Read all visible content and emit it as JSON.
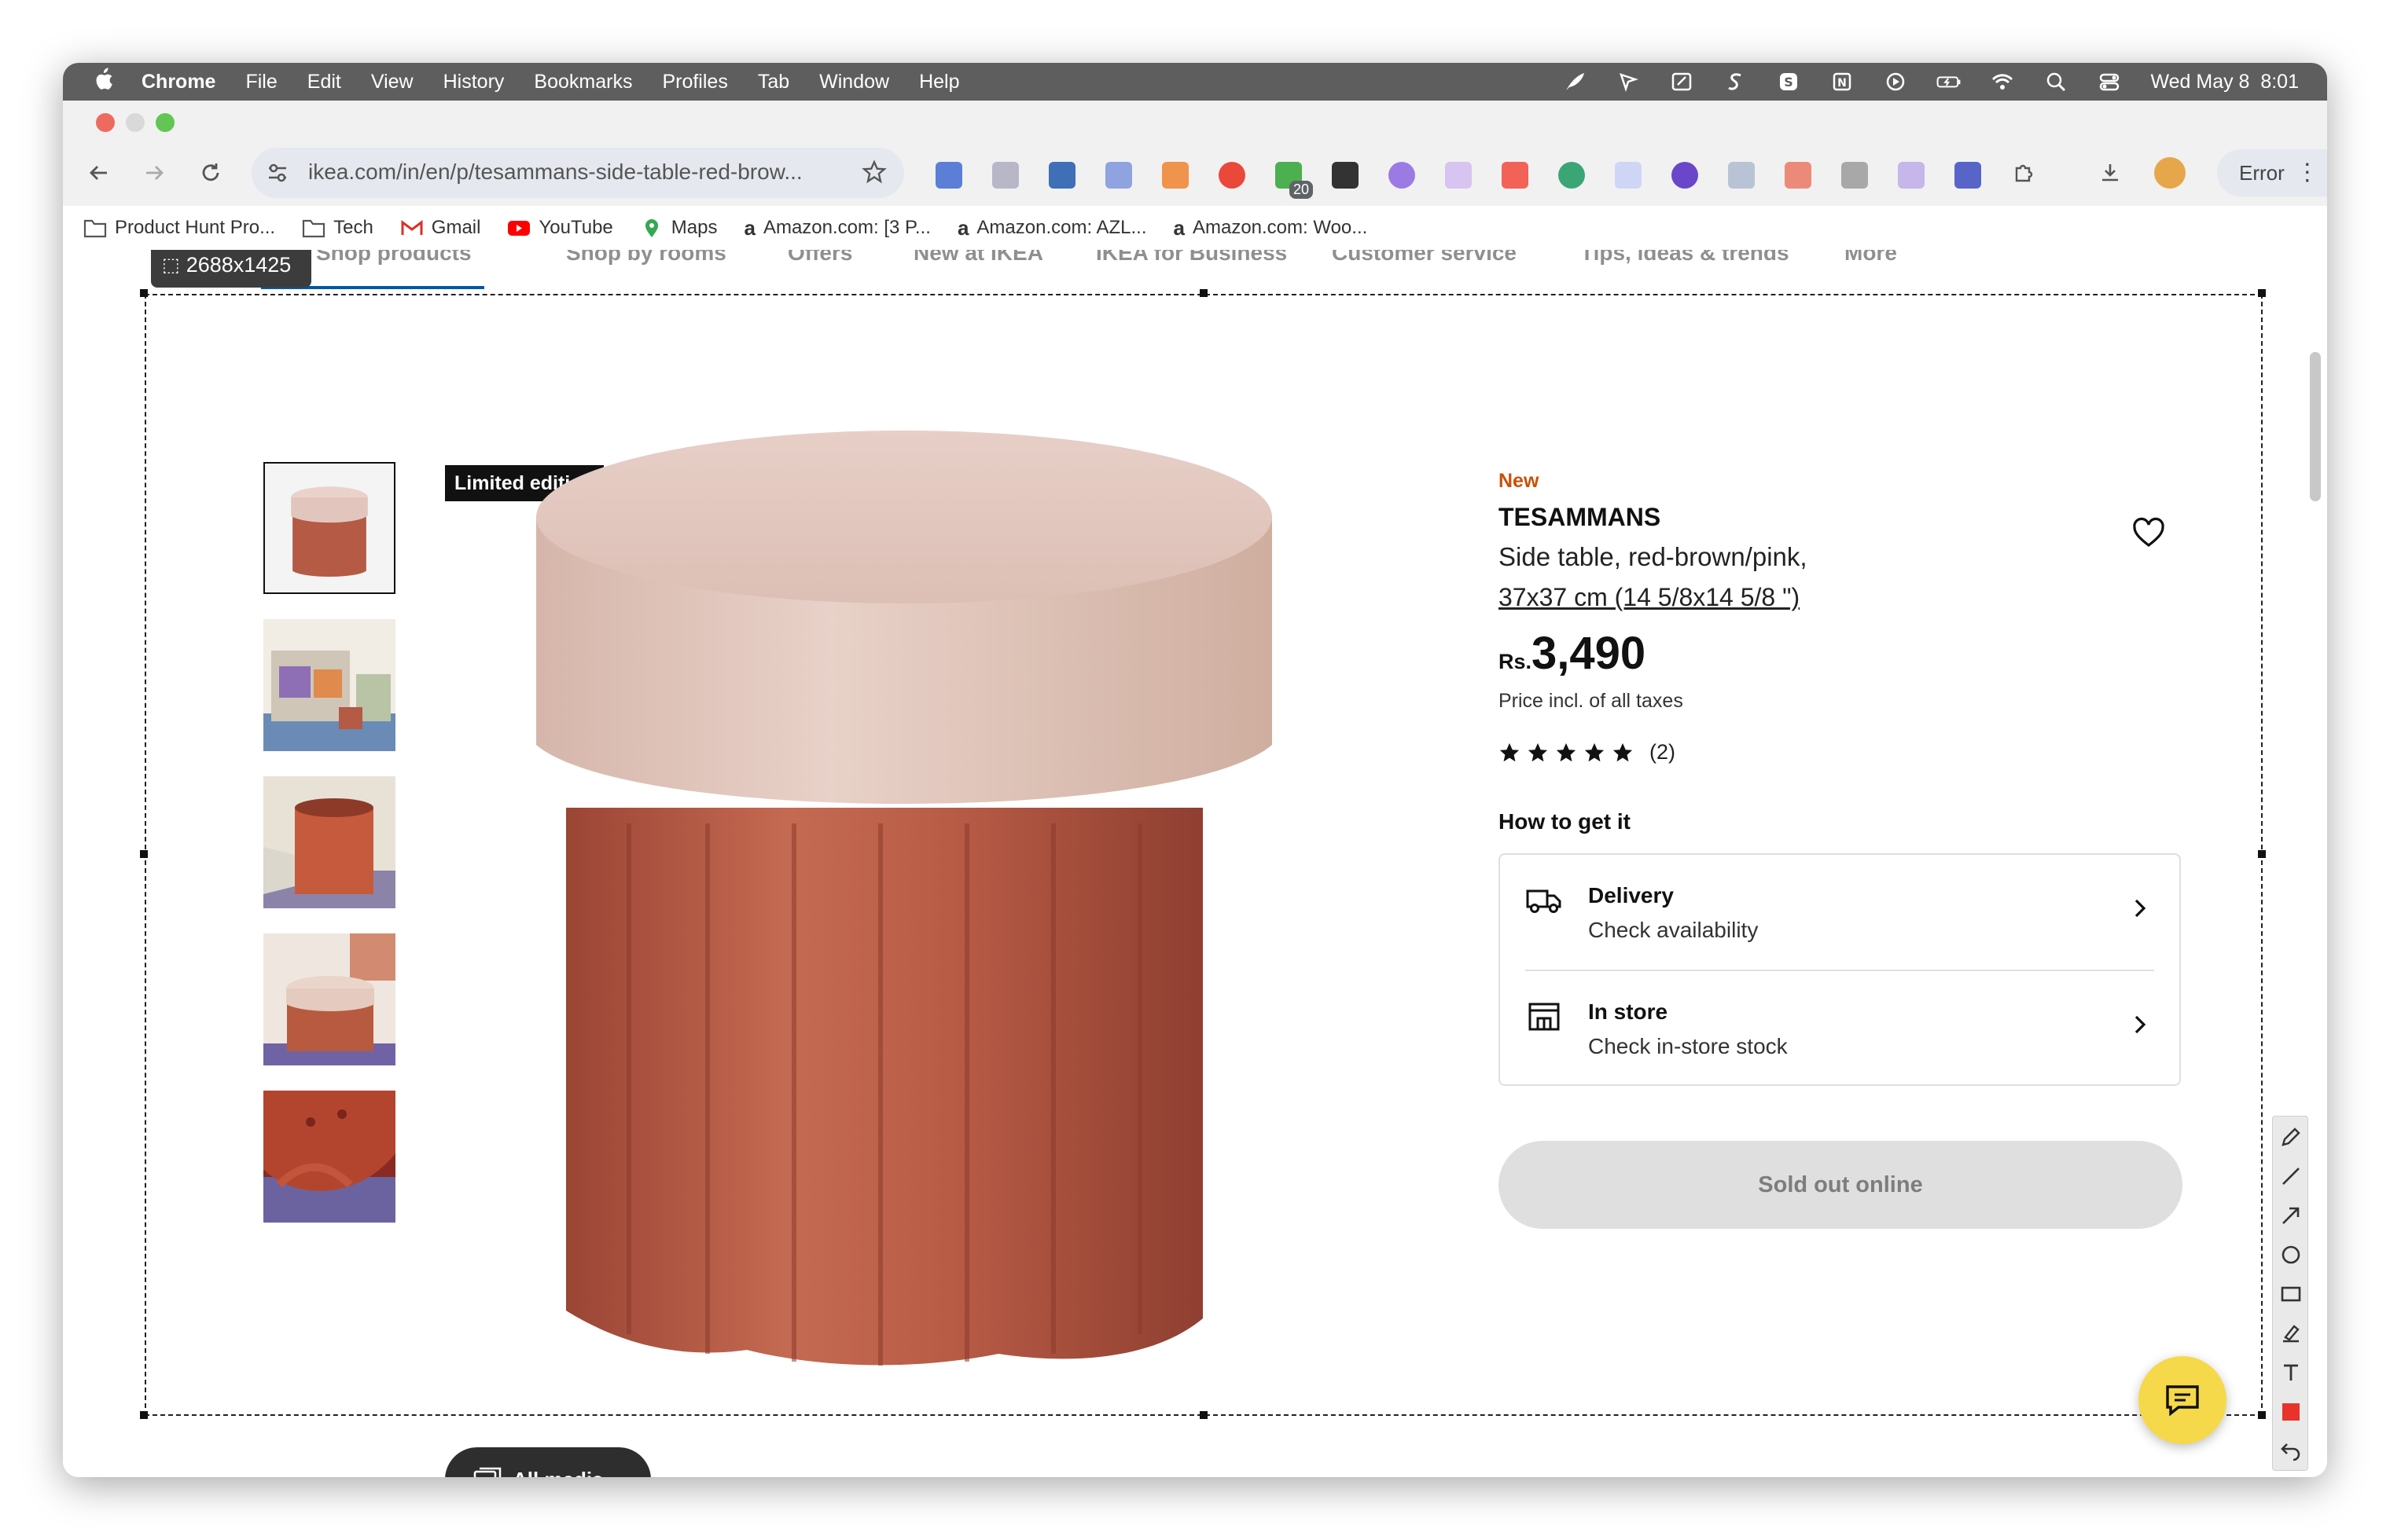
{
  "menubar": {
    "app": "Chrome",
    "items": [
      "File",
      "Edit",
      "View",
      "History",
      "Bookmarks",
      "Profiles",
      "Tab",
      "Window",
      "Help"
    ],
    "clock": "Wed May 8  8:01"
  },
  "toolbar": {
    "url": "ikea.com/in/en/p/tesammans-side-table-red-brow...",
    "extension_badge": "20",
    "error_label": "Error"
  },
  "bookmarks": [
    {
      "label": "Product Hunt Pro...",
      "icon": "folder-icon"
    },
    {
      "label": "Tech",
      "icon": "folder-icon"
    },
    {
      "label": "Gmail",
      "icon": "gmail-icon"
    },
    {
      "label": "YouTube",
      "icon": "youtube-icon"
    },
    {
      "label": "Maps",
      "icon": "maps-icon"
    },
    {
      "label": "Amazon.com: [3 P...",
      "icon": "amazon-icon"
    },
    {
      "label": "Amazon.com: AZL...",
      "icon": "amazon-icon"
    },
    {
      "label": "Amazon.com: Woo...",
      "icon": "amazon-icon"
    }
  ],
  "site_nav": [
    "Shop products",
    "Shop by rooms",
    "Offers",
    "New at IKEA",
    "IKEA for Business",
    "Customer service",
    "Tips, ideas & trends",
    "More"
  ],
  "capture": {
    "size_label": "2688x1425"
  },
  "gallery": {
    "badge": "Limited edition",
    "all_media_label": "All media"
  },
  "product": {
    "tag": "New",
    "name": "TESAMMANS",
    "description": "Side table, red-brown/pink,",
    "size": "37x37 cm (14 5/8x14 5/8 \")",
    "currency": "Rs.",
    "price": "3,490",
    "tax_note": "Price incl. of all taxes",
    "rating": 5,
    "review_count": "(2)"
  },
  "how_to_get": {
    "heading": "How to get it",
    "options": [
      {
        "title": "Delivery",
        "subtitle": "Check availability",
        "icon": "truck-icon"
      },
      {
        "title": "In store",
        "subtitle": "Check in-store stock",
        "icon": "store-icon"
      }
    ]
  },
  "buy_button": {
    "label": "Sold out online"
  },
  "colors": {
    "tag_orange": "#ca5008",
    "tabletop_pink": "#e2c6bd",
    "table_base": "#b45a45",
    "chat_yellow": "#f6d94a"
  }
}
